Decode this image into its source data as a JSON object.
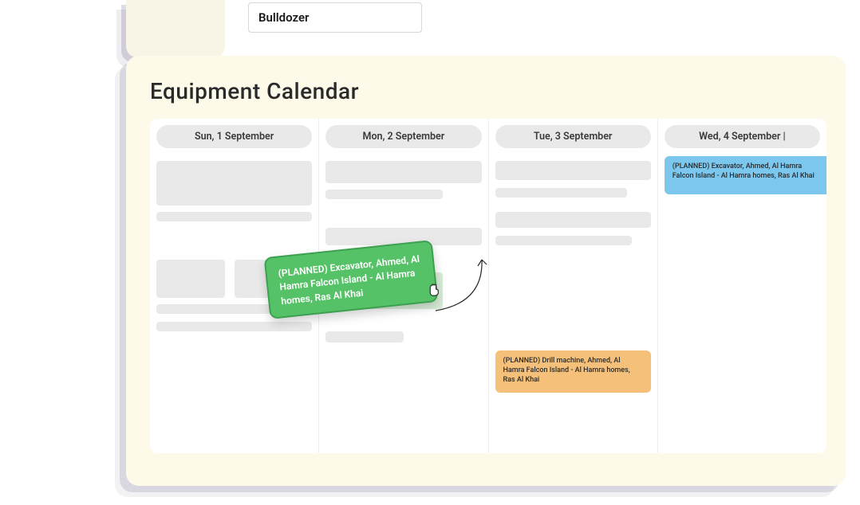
{
  "equipment_field": {
    "value": "Bulldozer"
  },
  "calendar": {
    "title": "Equipment Calendar",
    "days": [
      {
        "label": "Sun, 1 September"
      },
      {
        "label": "Mon, 2 September"
      },
      {
        "label": "Tue, 3 September"
      },
      {
        "label": "Wed, 4 September |"
      }
    ],
    "events": {
      "dragging_green": {
        "text": "(PLANNED) Excavator, Ahmed, Al Hamra Falcon Island - Al Hamra homes, Ras Al Khai"
      },
      "tue_orange": {
        "text": "(PLANNED) Drill machine, Ahmed, Al Hamra Falcon Island - Al Hamra homes, Ras Al Khai"
      },
      "wed_blue": {
        "text": "(PLANNED) Excavator, Ahmed, Al Hamra Falcon Island - Al Hamra homes, Ras Al Khai"
      }
    }
  }
}
